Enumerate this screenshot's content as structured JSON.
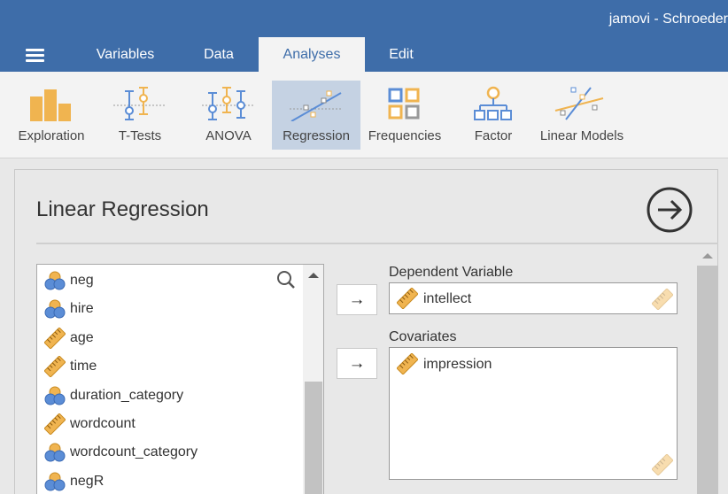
{
  "app": {
    "title": "jamovi - Schroeder"
  },
  "tabs": [
    {
      "label": "Variables"
    },
    {
      "label": "Data"
    },
    {
      "label": "Analyses",
      "active": true
    },
    {
      "label": "Edit"
    }
  ],
  "ribbon": [
    {
      "label": "Exploration",
      "icon": "exploration-icon"
    },
    {
      "label": "T-Tests",
      "icon": "t-tests-icon"
    },
    {
      "label": "ANOVA",
      "icon": "anova-icon"
    },
    {
      "label": "Regression",
      "icon": "regression-icon",
      "active": true
    },
    {
      "label": "Frequencies",
      "icon": "frequencies-icon"
    },
    {
      "label": "Factor",
      "icon": "factor-icon"
    },
    {
      "label": "Linear Models",
      "icon": "linear-models-icon"
    }
  ],
  "panel": {
    "title": "Linear Regression"
  },
  "variables": [
    {
      "name": "neg",
      "type": "nominal"
    },
    {
      "name": "hire",
      "type": "nominal"
    },
    {
      "name": "age",
      "type": "continuous"
    },
    {
      "name": "time",
      "type": "continuous"
    },
    {
      "name": "duration_category",
      "type": "nominal"
    },
    {
      "name": "wordcount",
      "type": "continuous"
    },
    {
      "name": "wordcount_category",
      "type": "nominal"
    },
    {
      "name": "negR",
      "type": "nominal"
    }
  ],
  "move_button": {
    "symbol": "→"
  },
  "dependent": {
    "label": "Dependent Variable",
    "value": "intellect"
  },
  "covariates": {
    "label": "Covariates",
    "items": [
      "impression"
    ]
  },
  "colors": {
    "topbar": "#3e6da9",
    "accent_orange": "#f0b450",
    "accent_blue": "#5b8dd6",
    "ribbon_active": "#c5d2e3"
  }
}
